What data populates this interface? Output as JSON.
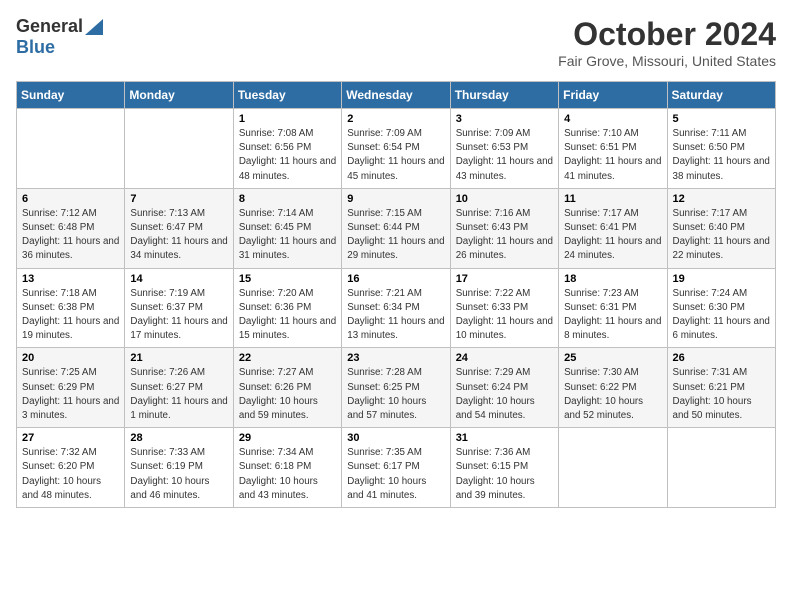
{
  "header": {
    "logo_general": "General",
    "logo_blue": "Blue",
    "title": "October 2024",
    "subtitle": "Fair Grove, Missouri, United States"
  },
  "weekdays": [
    "Sunday",
    "Monday",
    "Tuesday",
    "Wednesday",
    "Thursday",
    "Friday",
    "Saturday"
  ],
  "weeks": [
    [
      {
        "day": "",
        "sunrise": "",
        "sunset": "",
        "daylight": ""
      },
      {
        "day": "",
        "sunrise": "",
        "sunset": "",
        "daylight": ""
      },
      {
        "day": "1",
        "sunrise": "Sunrise: 7:08 AM",
        "sunset": "Sunset: 6:56 PM",
        "daylight": "Daylight: 11 hours and 48 minutes."
      },
      {
        "day": "2",
        "sunrise": "Sunrise: 7:09 AM",
        "sunset": "Sunset: 6:54 PM",
        "daylight": "Daylight: 11 hours and 45 minutes."
      },
      {
        "day": "3",
        "sunrise": "Sunrise: 7:09 AM",
        "sunset": "Sunset: 6:53 PM",
        "daylight": "Daylight: 11 hours and 43 minutes."
      },
      {
        "day": "4",
        "sunrise": "Sunrise: 7:10 AM",
        "sunset": "Sunset: 6:51 PM",
        "daylight": "Daylight: 11 hours and 41 minutes."
      },
      {
        "day": "5",
        "sunrise": "Sunrise: 7:11 AM",
        "sunset": "Sunset: 6:50 PM",
        "daylight": "Daylight: 11 hours and 38 minutes."
      }
    ],
    [
      {
        "day": "6",
        "sunrise": "Sunrise: 7:12 AM",
        "sunset": "Sunset: 6:48 PM",
        "daylight": "Daylight: 11 hours and 36 minutes."
      },
      {
        "day": "7",
        "sunrise": "Sunrise: 7:13 AM",
        "sunset": "Sunset: 6:47 PM",
        "daylight": "Daylight: 11 hours and 34 minutes."
      },
      {
        "day": "8",
        "sunrise": "Sunrise: 7:14 AM",
        "sunset": "Sunset: 6:45 PM",
        "daylight": "Daylight: 11 hours and 31 minutes."
      },
      {
        "day": "9",
        "sunrise": "Sunrise: 7:15 AM",
        "sunset": "Sunset: 6:44 PM",
        "daylight": "Daylight: 11 hours and 29 minutes."
      },
      {
        "day": "10",
        "sunrise": "Sunrise: 7:16 AM",
        "sunset": "Sunset: 6:43 PM",
        "daylight": "Daylight: 11 hours and 26 minutes."
      },
      {
        "day": "11",
        "sunrise": "Sunrise: 7:17 AM",
        "sunset": "Sunset: 6:41 PM",
        "daylight": "Daylight: 11 hours and 24 minutes."
      },
      {
        "day": "12",
        "sunrise": "Sunrise: 7:17 AM",
        "sunset": "Sunset: 6:40 PM",
        "daylight": "Daylight: 11 hours and 22 minutes."
      }
    ],
    [
      {
        "day": "13",
        "sunrise": "Sunrise: 7:18 AM",
        "sunset": "Sunset: 6:38 PM",
        "daylight": "Daylight: 11 hours and 19 minutes."
      },
      {
        "day": "14",
        "sunrise": "Sunrise: 7:19 AM",
        "sunset": "Sunset: 6:37 PM",
        "daylight": "Daylight: 11 hours and 17 minutes."
      },
      {
        "day": "15",
        "sunrise": "Sunrise: 7:20 AM",
        "sunset": "Sunset: 6:36 PM",
        "daylight": "Daylight: 11 hours and 15 minutes."
      },
      {
        "day": "16",
        "sunrise": "Sunrise: 7:21 AM",
        "sunset": "Sunset: 6:34 PM",
        "daylight": "Daylight: 11 hours and 13 minutes."
      },
      {
        "day": "17",
        "sunrise": "Sunrise: 7:22 AM",
        "sunset": "Sunset: 6:33 PM",
        "daylight": "Daylight: 11 hours and 10 minutes."
      },
      {
        "day": "18",
        "sunrise": "Sunrise: 7:23 AM",
        "sunset": "Sunset: 6:31 PM",
        "daylight": "Daylight: 11 hours and 8 minutes."
      },
      {
        "day": "19",
        "sunrise": "Sunrise: 7:24 AM",
        "sunset": "Sunset: 6:30 PM",
        "daylight": "Daylight: 11 hours and 6 minutes."
      }
    ],
    [
      {
        "day": "20",
        "sunrise": "Sunrise: 7:25 AM",
        "sunset": "Sunset: 6:29 PM",
        "daylight": "Daylight: 11 hours and 3 minutes."
      },
      {
        "day": "21",
        "sunrise": "Sunrise: 7:26 AM",
        "sunset": "Sunset: 6:27 PM",
        "daylight": "Daylight: 11 hours and 1 minute."
      },
      {
        "day": "22",
        "sunrise": "Sunrise: 7:27 AM",
        "sunset": "Sunset: 6:26 PM",
        "daylight": "Daylight: 10 hours and 59 minutes."
      },
      {
        "day": "23",
        "sunrise": "Sunrise: 7:28 AM",
        "sunset": "Sunset: 6:25 PM",
        "daylight": "Daylight: 10 hours and 57 minutes."
      },
      {
        "day": "24",
        "sunrise": "Sunrise: 7:29 AM",
        "sunset": "Sunset: 6:24 PM",
        "daylight": "Daylight: 10 hours and 54 minutes."
      },
      {
        "day": "25",
        "sunrise": "Sunrise: 7:30 AM",
        "sunset": "Sunset: 6:22 PM",
        "daylight": "Daylight: 10 hours and 52 minutes."
      },
      {
        "day": "26",
        "sunrise": "Sunrise: 7:31 AM",
        "sunset": "Sunset: 6:21 PM",
        "daylight": "Daylight: 10 hours and 50 minutes."
      }
    ],
    [
      {
        "day": "27",
        "sunrise": "Sunrise: 7:32 AM",
        "sunset": "Sunset: 6:20 PM",
        "daylight": "Daylight: 10 hours and 48 minutes."
      },
      {
        "day": "28",
        "sunrise": "Sunrise: 7:33 AM",
        "sunset": "Sunset: 6:19 PM",
        "daylight": "Daylight: 10 hours and 46 minutes."
      },
      {
        "day": "29",
        "sunrise": "Sunrise: 7:34 AM",
        "sunset": "Sunset: 6:18 PM",
        "daylight": "Daylight: 10 hours and 43 minutes."
      },
      {
        "day": "30",
        "sunrise": "Sunrise: 7:35 AM",
        "sunset": "Sunset: 6:17 PM",
        "daylight": "Daylight: 10 hours and 41 minutes."
      },
      {
        "day": "31",
        "sunrise": "Sunrise: 7:36 AM",
        "sunset": "Sunset: 6:15 PM",
        "daylight": "Daylight: 10 hours and 39 minutes."
      },
      {
        "day": "",
        "sunrise": "",
        "sunset": "",
        "daylight": ""
      },
      {
        "day": "",
        "sunrise": "",
        "sunset": "",
        "daylight": ""
      }
    ]
  ]
}
